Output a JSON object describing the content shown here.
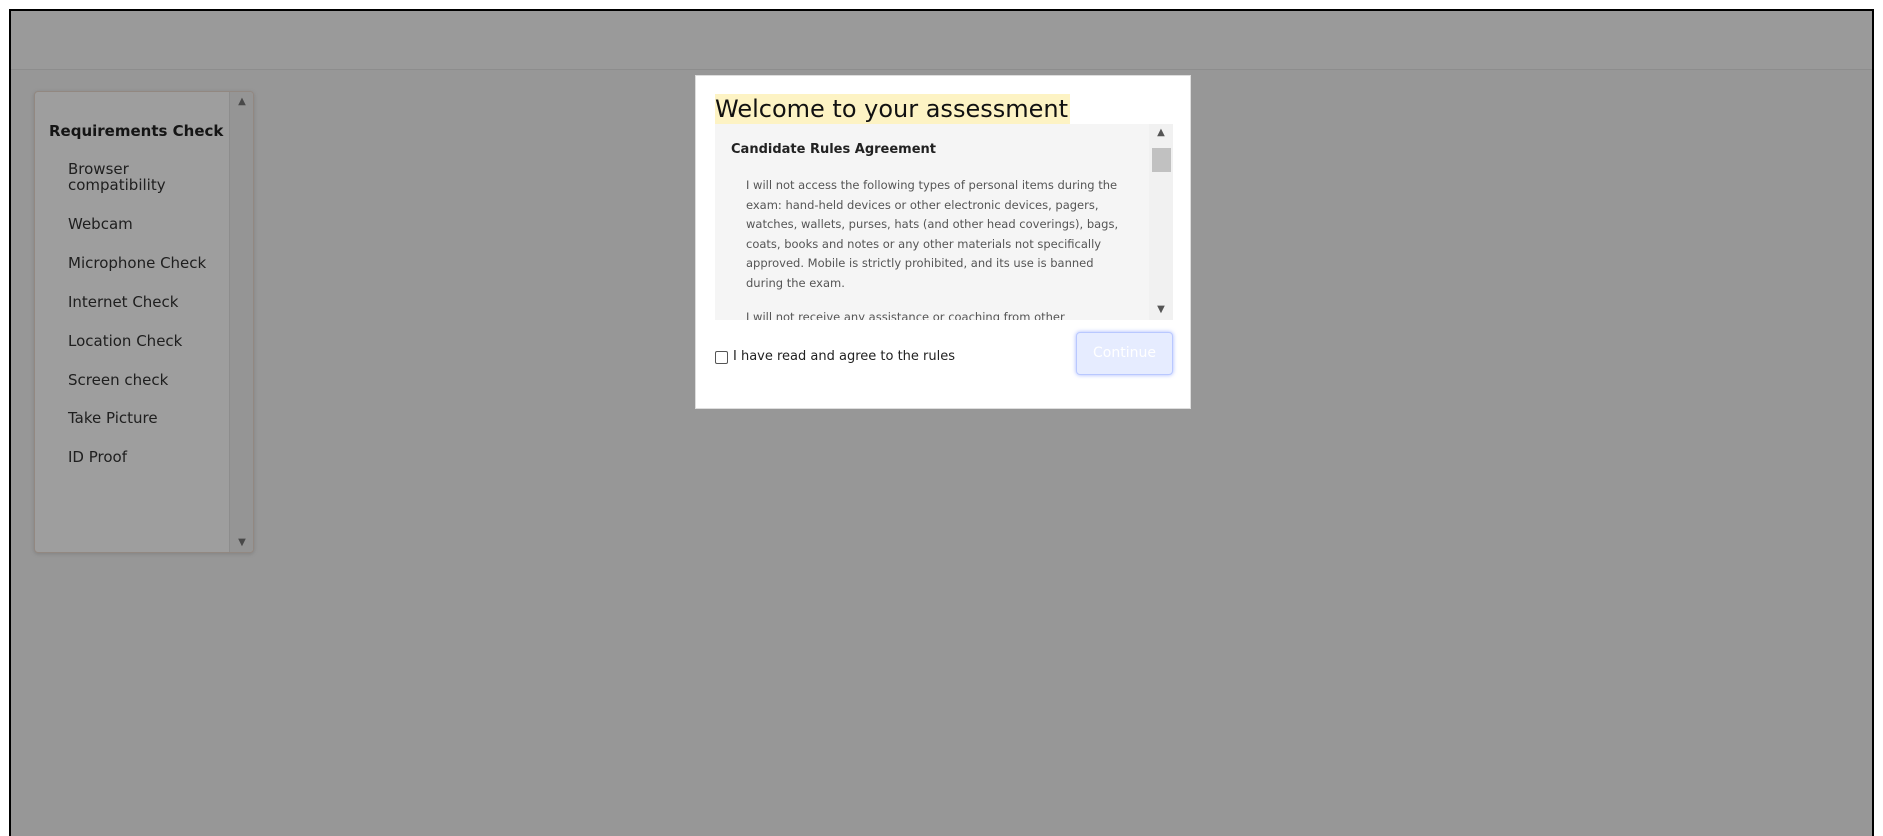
{
  "sidebar": {
    "title": "Requirements Check",
    "items": [
      {
        "label": "Browser compatibility"
      },
      {
        "label": "Webcam"
      },
      {
        "label": "Microphone Check"
      },
      {
        "label": "Internet Check"
      },
      {
        "label": "Location Check"
      },
      {
        "label": "Screen check"
      },
      {
        "label": "Take Picture"
      },
      {
        "label": "ID Proof"
      }
    ]
  },
  "modal": {
    "title": "Welcome to your assessment",
    "rules": {
      "heading": "Candidate Rules Agreement",
      "paragraphs": [
        "I will not access the following types of personal items during the exam: hand-held devices or other electronic devices, pagers, watches, wallets, purses, hats (and other head coverings), bags, coats, books and notes or any other materials not specifically approved. Mobile is strictly prohibited, and its use is banned during the exam.",
        "I will not receive any assistance or coaching from other individuals"
      ]
    },
    "agree_label": "I have read and agree to the rules",
    "continue_label": "Continue"
  },
  "icons": {
    "scroll_up": "arrow-up-icon",
    "scroll_down": "arrow-down-icon"
  },
  "colors": {
    "overlay": "#000000",
    "title_highlight": "#fdf3c4",
    "continue_bg": "#e6ecff",
    "continue_border": "#b9c8ff"
  }
}
